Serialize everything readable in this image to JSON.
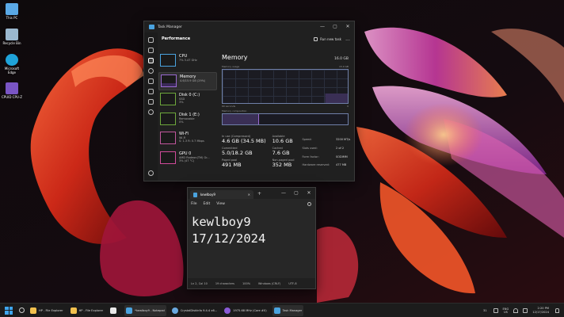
{
  "desktop": {
    "icons": [
      {
        "label": "This PC",
        "color": "#5aa9e6"
      },
      {
        "label": "Recycle Bin",
        "color": "#9bb8cf"
      },
      {
        "label": "Microsoft Edge",
        "color": "#1fa3d9"
      },
      {
        "label": "CPUID CPU-Z",
        "color": "#7a55c4"
      }
    ]
  },
  "task_manager": {
    "title": "Task Manager",
    "page_title": "Performance",
    "run_new_task": "Run new task",
    "more": "...",
    "window_controls": {
      "minimize": "—",
      "maximize": "▢",
      "close": "✕"
    },
    "items": [
      {
        "title": "CPU",
        "sub1": "7% 3.47 GHz",
        "sub2": "",
        "color": "#4aa3df"
      },
      {
        "title": "Memory",
        "sub1": "4.6/15.9 GB (29%)",
        "sub2": "",
        "color": "#9a6ad1"
      },
      {
        "title": "Disk 0 (C:)",
        "sub1": "SSD",
        "sub2": "3%",
        "color": "#6ea83c"
      },
      {
        "title": "Disk 1 (E:)",
        "sub1": "Removable",
        "sub2": "0%",
        "color": "#6ea83c"
      },
      {
        "title": "Wi-Fi",
        "sub1": "Wi-Fi",
        "sub2": "S: 1.3 R: 0.7 Mbps",
        "color": "#c0569c"
      },
      {
        "title": "GPU 0",
        "sub1": "AMD Radeon(TM) Gr...",
        "sub2": "3% (47 °C)",
        "color": "#d14b9a"
      }
    ],
    "memory": {
      "title": "Memory",
      "total": "16.0 GB",
      "usage_label": "Memory usage",
      "usage_max": "15.9 GB",
      "graph_span": "60 seconds",
      "graph_min": "0",
      "usage_fraction": 0.29,
      "composition_label": "Memory composition",
      "composition_in_use": 0.29,
      "stats": {
        "in_use_label": "In use (Compressed)",
        "in_use": "4.6 GB (34.5 MB)",
        "available_label": "Available",
        "available": "10.6 GB",
        "committed_label": "Committed",
        "committed": "5.0/18.2 GB",
        "cached_label": "Cached",
        "cached": "7.6 GB",
        "paged_label": "Paged pool",
        "paged": "491 MB",
        "nonpaged_label": "Non-paged pool",
        "nonpaged": "352 MB"
      },
      "specs": [
        {
          "label": "Speed:",
          "value": "3200 MT/s"
        },
        {
          "label": "Slots used:",
          "value": "2 of 2"
        },
        {
          "label": "Form factor:",
          "value": "SODIMM"
        },
        {
          "label": "Hardware reserved:",
          "value": "477 MB"
        }
      ]
    },
    "accent": "#9a6ad1"
  },
  "notepad": {
    "tab_title": "kewlboy9",
    "tab_close": "✕",
    "new_tab": "+",
    "window_controls": {
      "minimize": "—",
      "maximize": "▢",
      "close": "✕"
    },
    "menu": {
      "file": "File",
      "edit": "Edit",
      "view": "View"
    },
    "line1": "kewlboy9",
    "line2": "17/12/2024",
    "status": {
      "position": "Ln 2, Col 10",
      "chars": "19 characters",
      "zoom": "100%",
      "line_endings": "Windows (CRLF)",
      "encoding": "UTF-8"
    }
  },
  "taskbar": {
    "apps": [
      {
        "label": "HP - File Explorer",
        "color": "#f2c14e",
        "active": false
      },
      {
        "label": "HP - File Explorer",
        "color": "#f2c14e",
        "active": false
      },
      {
        "label": "",
        "color": "#e9e9e9",
        "active": false
      },
      {
        "label": "*kewlboy9 - Notepad",
        "color": "#4aa3df",
        "active": true
      },
      {
        "label": "CrystalDiskInfo 9.4.4 x6...",
        "color": "#6aa9e0",
        "active": false
      },
      {
        "label": "1975.68 MHz (Core #0)",
        "color": "#8a5ad6",
        "active": false
      },
      {
        "label": "Task Manager",
        "color": "#4aa3df",
        "active": true
      }
    ],
    "tray": {
      "weather": "31",
      "lang_top": "ENG",
      "lang_bottom": "US",
      "time": "2:20 PM",
      "date": "12/17/2024"
    }
  }
}
